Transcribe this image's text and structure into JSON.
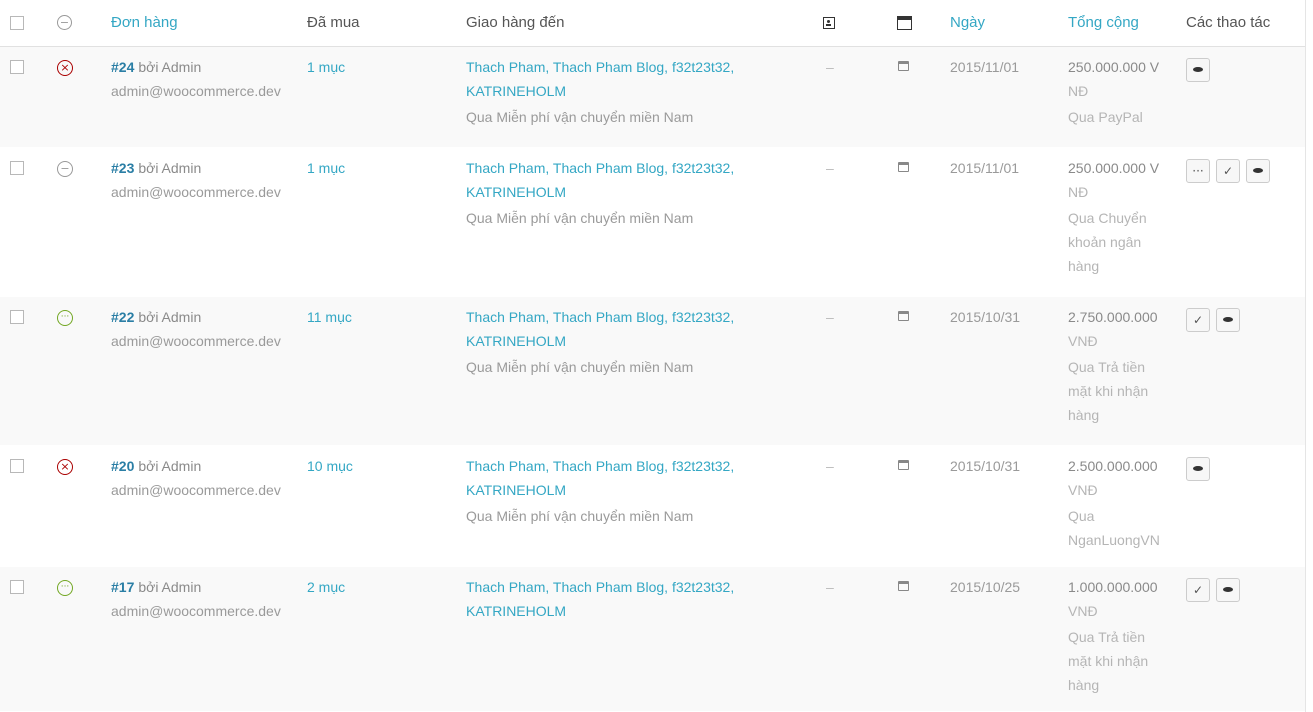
{
  "header": {
    "order": "Đơn hàng",
    "purchased": "Đã mua",
    "ship_to": "Giao hàng đến",
    "date": "Ngày",
    "total": "Tổng cộng",
    "actions": "Các thao tác",
    "customer_message_icon": "customer-message-icon",
    "order_notes_icon": "order-notes-icon"
  },
  "orders": [
    {
      "status": "cancelled",
      "id": "#24",
      "by": "bởi Admin",
      "email": "admin@woocommerce.dev",
      "purchased": "1 mục",
      "address_line1": "Thach Pham, Thach Pham Blog, f32t23t32,",
      "address_line2": "KATRINEHOLM",
      "shipping": "Qua Miễn phí vận chuyển miền Nam",
      "dash": "–",
      "date": "2015/11/01",
      "total_lines": [
        "250.000.000 V",
        "NĐ"
      ],
      "payment_lines": [
        "Qua PayPal"
      ],
      "actions": [
        "view"
      ]
    },
    {
      "status": "on-hold",
      "id": "#23",
      "by": "bởi Admin",
      "email": "admin@woocommerce.dev",
      "purchased": "1 mục",
      "address_line1": "Thach Pham, Thach Pham Blog, f32t23t32,",
      "address_line2": "KATRINEHOLM",
      "shipping": "Qua Miễn phí vận chuyển miền Nam",
      "dash": "–",
      "date": "2015/11/01",
      "total_lines": [
        "250.000.000 V",
        "NĐ"
      ],
      "payment_lines": [
        "Qua Chuyển",
        "khoản ngân",
        "hàng"
      ],
      "actions": [
        "processing",
        "complete",
        "view"
      ]
    },
    {
      "status": "processing",
      "id": "#22",
      "by": "bởi Admin",
      "email": "admin@woocommerce.dev",
      "purchased": "11 mục",
      "address_line1": "Thach Pham, Thach Pham Blog, f32t23t32,",
      "address_line2": "KATRINEHOLM",
      "shipping": "Qua Miễn phí vận chuyển miền Nam",
      "dash": "–",
      "date": "2015/10/31",
      "total_lines": [
        "2.750.000.000",
        "VNĐ"
      ],
      "payment_lines": [
        "Qua Trả tiền",
        "mặt khi nhận",
        "hàng"
      ],
      "actions": [
        "complete",
        "view"
      ]
    },
    {
      "status": "cancelled",
      "id": "#20",
      "by": "bởi Admin",
      "email": "admin@woocommerce.dev",
      "purchased": "10 mục",
      "address_line1": "Thach Pham, Thach Pham Blog, f32t23t32,",
      "address_line2": "KATRINEHOLM",
      "shipping": "Qua Miễn phí vận chuyển miền Nam",
      "dash": "–",
      "date": "2015/10/31",
      "total_lines": [
        "2.500.000.000",
        "VNĐ"
      ],
      "payment_lines": [
        "Qua",
        "NganLuongVN"
      ],
      "actions": [
        "view"
      ]
    },
    {
      "status": "processing",
      "id": "#17",
      "by": "bởi Admin",
      "email": "admin@woocommerce.dev",
      "purchased": "2 mục",
      "address_line1": "Thach Pham, Thach Pham Blog, f32t23t32,",
      "address_line2": "KATRINEHOLM",
      "shipping": "",
      "dash": "–",
      "date": "2015/10/25",
      "total_lines": [
        "1.000.000.000",
        "VNĐ"
      ],
      "payment_lines": [
        "Qua Trả tiền",
        "mặt khi nhận",
        "hàng"
      ],
      "actions": [
        "complete",
        "view"
      ]
    }
  ],
  "colors": {
    "link": "#34a7c4",
    "order_id": "#2a7ea5",
    "cancelled": "#aa0000",
    "processing": "#73a724",
    "on_hold": "#999999",
    "row_alt": "#f9f9f9"
  }
}
